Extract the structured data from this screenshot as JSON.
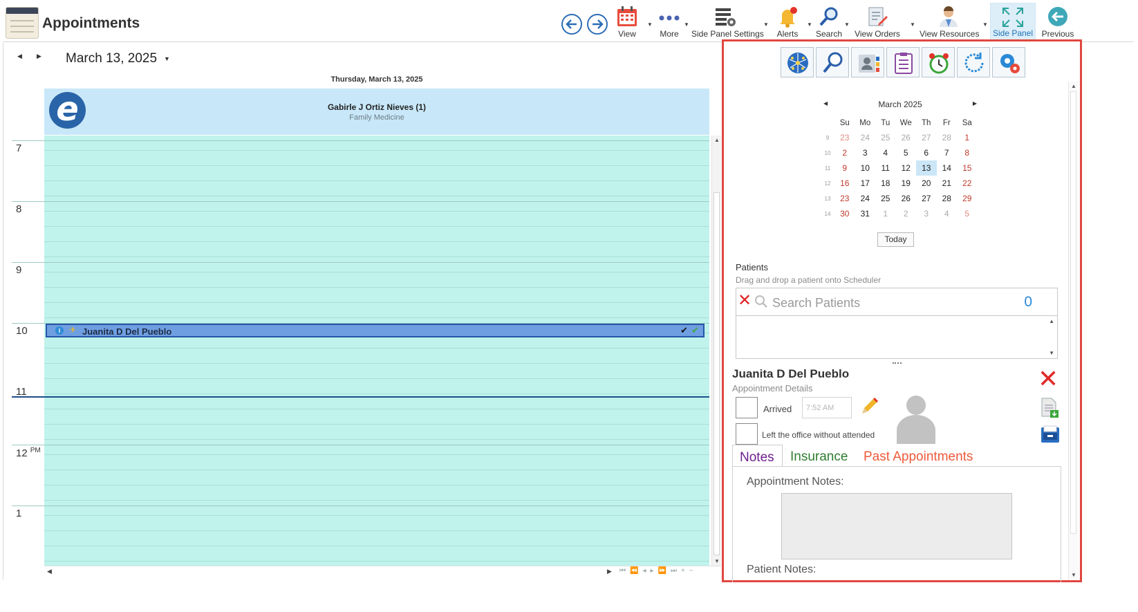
{
  "app": {
    "title": "Appointments"
  },
  "toolbar": {
    "view": "View",
    "more": "More",
    "side_panel_settings": "Side Panel Settings",
    "alerts": "Alerts",
    "search": "Search",
    "view_orders": "View Orders",
    "view_resources": "View Resources",
    "side_panel": "Side Panel",
    "previous": "Previous"
  },
  "scheduler": {
    "date": "March 13, 2025",
    "day_header": "Thursday, March 13, 2025",
    "resource": {
      "name": "Gabirle J Ortiz Nieves (1)",
      "specialty": "Family Medicine"
    },
    "hours": [
      "7",
      "8",
      "9",
      "10",
      "11",
      "12",
      "1"
    ],
    "pm_marker": "PM",
    "appointment": {
      "patient": "Juanita D Del Pueblo"
    }
  },
  "side_panel": {
    "calendar": {
      "month": "March 2025",
      "weekdays": [
        "Su",
        "Mo",
        "Tu",
        "We",
        "Th",
        "Fr",
        "Sa"
      ],
      "weeks": [
        {
          "wk": "9",
          "days": [
            "23",
            "24",
            "25",
            "26",
            "27",
            "28",
            "1"
          ]
        },
        {
          "wk": "10",
          "days": [
            "2",
            "3",
            "4",
            "5",
            "6",
            "7",
            "8"
          ]
        },
        {
          "wk": "11",
          "days": [
            "9",
            "10",
            "11",
            "12",
            "13",
            "14",
            "15"
          ]
        },
        {
          "wk": "12",
          "days": [
            "16",
            "17",
            "18",
            "19",
            "20",
            "21",
            "22"
          ]
        },
        {
          "wk": "13",
          "days": [
            "23",
            "24",
            "25",
            "26",
            "27",
            "28",
            "29"
          ]
        },
        {
          "wk": "14",
          "days": [
            "30",
            "31",
            "1",
            "2",
            "3",
            "4",
            "5"
          ]
        }
      ],
      "selected_day": "13",
      "today_label": "Today"
    },
    "patients": {
      "label": "Patients",
      "hint": "Drag and drop a patient onto Scheduler",
      "search_placeholder": "Search Patients",
      "count": "0"
    },
    "appointment_details": {
      "patient": "Juanita D Del Pueblo",
      "subtitle": "Appointment Details",
      "arrived_label": "Arrived",
      "arrived_time": "7:52 AM",
      "left_label": "Left the office without attended"
    },
    "tabs": {
      "notes": "Notes",
      "insurance": "Insurance",
      "past": "Past Appointments"
    },
    "notes": {
      "appointment_label": "Appointment Notes:",
      "patient_label": "Patient Notes:"
    }
  },
  "colors": {
    "accent": "#2c6db6",
    "grid": "#bff3ec",
    "resource_header": "#c8e8f9",
    "appointment": "#6f9fe0",
    "highlight_border": "#e0473f"
  }
}
